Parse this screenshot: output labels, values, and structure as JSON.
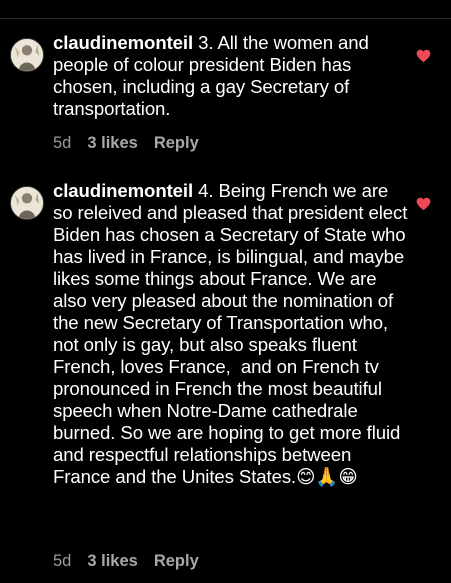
{
  "comments": [
    {
      "username": "claudinemonteil",
      "text": " 3. All the women and people of colour president Biden has chosen, including a gay Secretary of transportation.",
      "age": "5d",
      "likes": "3 likes",
      "reply_label": "Reply",
      "avatar_icon": "avatar-icon",
      "like_icon": "heart-icon",
      "like_color": "#ed4956"
    },
    {
      "username": "claudinemonteil",
      "text": " 4. Being French we are so releived and pleased that president elect Biden has chosen a Secretary of State who has lived in France, is bilingual, and maybe likes some things about France. We are also very pleased about the nomination of the new Secretary of Transportation who, not only is gay, but also speaks fluent French, loves France,  and on French tv pronounced in French the most beautiful speech when Notre-Dame cathedrale burned. So we are hoping to get more fluid and respectful relationships between France and the Unites States.😊🙏😁",
      "age": "5d",
      "likes": "3 likes",
      "reply_label": "Reply",
      "avatar_icon": "avatar-icon",
      "like_icon": "heart-icon",
      "like_color": "#ed4956"
    }
  ]
}
